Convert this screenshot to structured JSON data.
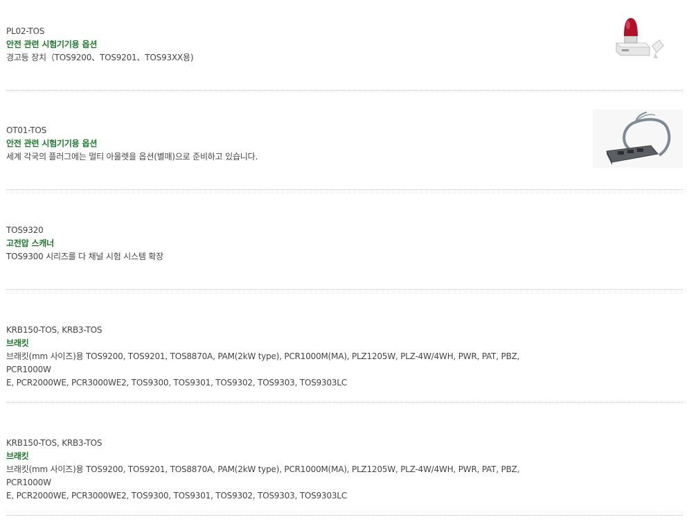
{
  "items": [
    {
      "code": "PL02-TOS",
      "category": "안전 관련 시험기기용 옵션",
      "description": "경고등 장치（TOS9200、TOS9201、TOS93XX용)",
      "image": "warning-light-unit"
    },
    {
      "code": "OT01-TOS",
      "category": "안전 관련 시험기기용 옵션",
      "description": "세계 각국의 플러그에는 멀티 아울렛을 옵션(별매)으로 준비하고 있습니다.",
      "image": "multi-outlet-cable"
    },
    {
      "code": "TOS9320",
      "category": "고전압 스캐너",
      "description": "TOS9300 시리즈를 다 채널 시험 시스템 확장"
    },
    {
      "code": "KRB150-TOS, KRB3-TOS",
      "category": "브래킷",
      "description_line1": "브래킷(mm 사이즈)용 TOS9200, TOS9201, TOS8870A, PAM(2kW type), PCR1000M(MA), PLZ1205W, PLZ-4W/4WH, PWR, PAT, PBZ, PCR1000W",
      "description_line2": "E, PCR2000WE, PCR3000WE2, TOS9300, TOS9301, TOS9302, TOS9303, TOS9303LC"
    },
    {
      "code": "KRB150-TOS, KRB3-TOS",
      "category": "브래킷",
      "description_line1": "브래킷(mm 사이즈)용 TOS9200, TOS9201, TOS8870A, PAM(2kW type), PCR1000M(MA), PLZ1205W, PLZ-4W/4WH, PWR, PAT, PBZ, PCR1000W",
      "description_line2": "E, PCR2000WE, PCR3000WE2, TOS9300, TOS9301, TOS9302, TOS9303, TOS9303LC"
    }
  ],
  "colors": {
    "category_green": "#1d7a2a",
    "text_gray": "#444444",
    "divider": "#b8b8b8"
  }
}
